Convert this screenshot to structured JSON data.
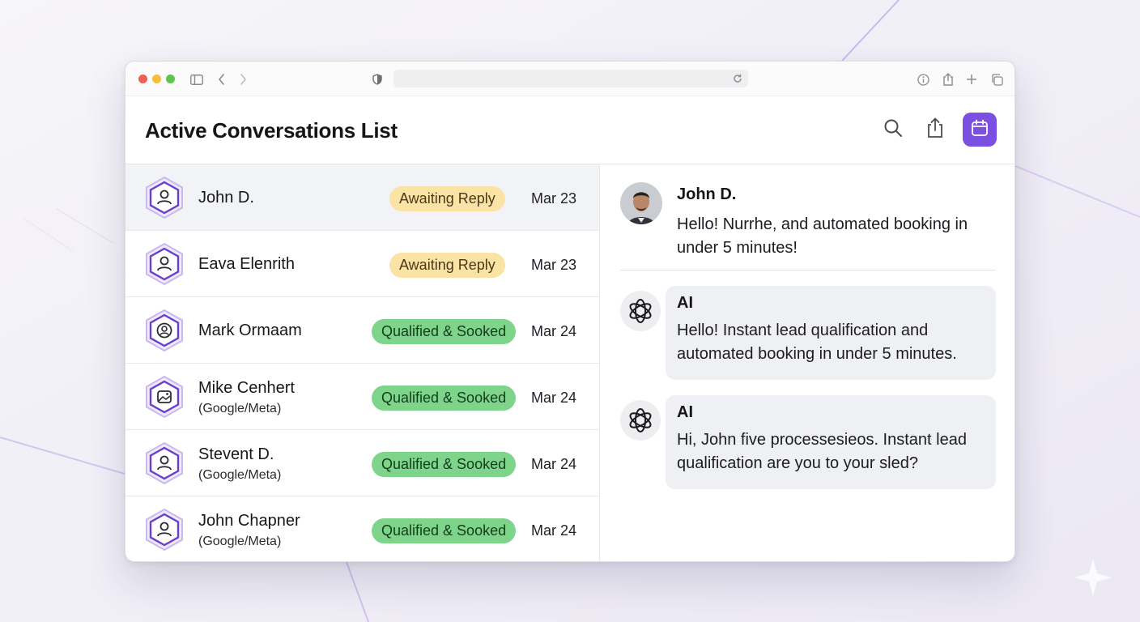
{
  "header": {
    "title": "Active Conversations List"
  },
  "colors": {
    "accent": "#7b4fe0",
    "awaiting_badge": "#fbe2a5",
    "qualified_badge": "#7fd48c"
  },
  "conversations": [
    {
      "name": "John D.",
      "sub": "",
      "status": "Awaiting Reply",
      "date": "Mar 23",
      "icon": "user-icon"
    },
    {
      "name": "Eava Elenrith",
      "sub": "",
      "status": "Awaiting Reply",
      "date": "Mar 23",
      "icon": "user-icon"
    },
    {
      "name": "Mark Ormaam",
      "sub": "",
      "status": "Qualified & Sooked",
      "date": "Mar 24",
      "icon": "user-circle-icon"
    },
    {
      "name": "Mike Cenhert",
      "sub": "(Google/Meta)",
      "status": "Qualified & Sooked",
      "date": "Mar 24",
      "icon": "image-icon"
    },
    {
      "name": "Stevent D.",
      "sub": "(Google/Meta)",
      "status": "Qualified & Sooked",
      "date": "Mar 24",
      "icon": "user-icon"
    },
    {
      "name": "John Chapner",
      "sub": "(Google/Meta)",
      "status": "Qualified & Sooked",
      "date": "Mar 24",
      "icon": "user-icon"
    }
  ],
  "chat": {
    "user_message": {
      "sender": "John D.",
      "text": "Hello! Nurrhe, and automated booking in under 5 minutes!"
    },
    "ai_messages": [
      {
        "sender": "AI",
        "text": "Hello! Instant lead qualification and automated booking in under 5 minutes."
      },
      {
        "sender": "AI",
        "text": "Hi, John five processesieos. Instant lead qualification are you to your sled?"
      }
    ]
  }
}
